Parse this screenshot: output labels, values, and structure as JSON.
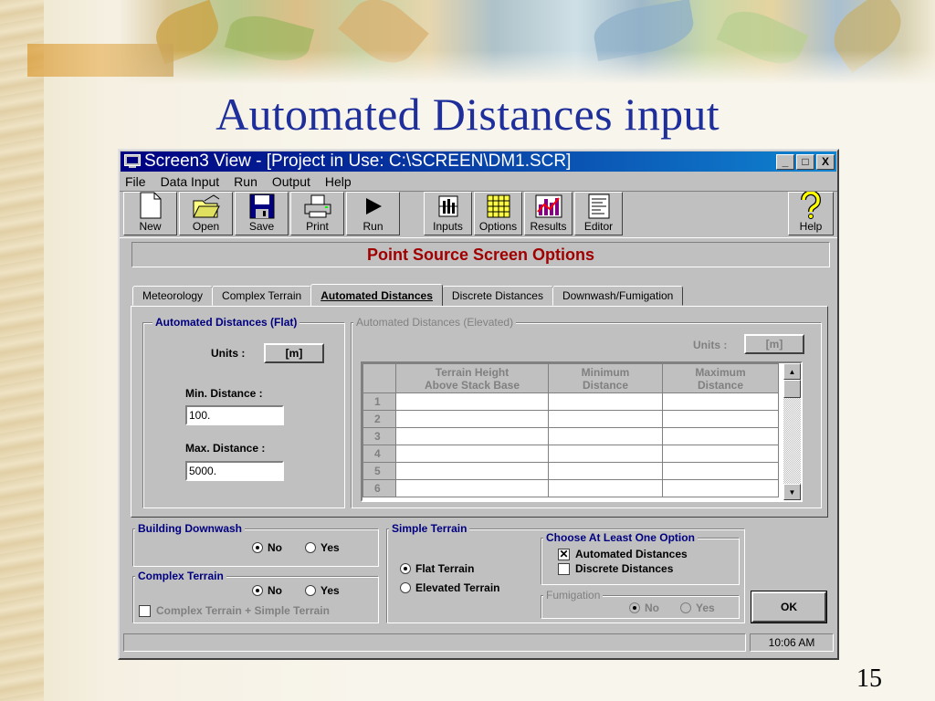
{
  "slide": {
    "title": "Automated Distances input",
    "page_number": "15"
  },
  "window": {
    "title": "Screen3 View - [Project in Use: C:\\SCREEN\\DM1.SCR]",
    "controls": [
      "_",
      "□",
      "X"
    ]
  },
  "menu": [
    "File",
    "Data Input",
    "Run",
    "Output",
    "Help"
  ],
  "toolbar": {
    "buttons": [
      {
        "label": "New",
        "icon": "new-document-icon"
      },
      {
        "label": "Open",
        "icon": "open-folder-icon"
      },
      {
        "label": "Save",
        "icon": "floppy-disk-icon"
      },
      {
        "label": "Print",
        "icon": "printer-icon"
      },
      {
        "label": "Run",
        "icon": "play-icon"
      },
      {
        "label": "Inputs",
        "icon": "inputs-icon"
      },
      {
        "label": "Options",
        "icon": "options-grid-icon"
      },
      {
        "label": "Results",
        "icon": "bar-chart-icon"
      },
      {
        "label": "Editor",
        "icon": "editor-document-icon"
      },
      {
        "label": "Help",
        "icon": "question-mark-icon"
      }
    ]
  },
  "screen_heading": "Point Source Screen Options",
  "tabs": [
    {
      "label": "Meteorology",
      "active": false
    },
    {
      "label": "Complex Terrain",
      "active": false
    },
    {
      "label": "Automated Distances",
      "active": true
    },
    {
      "label": "Discrete Distances",
      "active": false
    },
    {
      "label": "Downwash/Fumigation",
      "active": false
    }
  ],
  "flat": {
    "legend": "Automated Distances (Flat)",
    "units_label": "Units :",
    "units_value": "[m]",
    "min_label": "Min. Distance :",
    "min_value": "100.",
    "max_label": "Max. Distance :",
    "max_value": "5000."
  },
  "elevated": {
    "legend": "Automated Distances (Elevated)",
    "units_label": "Units :",
    "units_value": "[m]",
    "columns": [
      [
        "Terrain Height",
        "Above Stack Base"
      ],
      [
        "Minimum",
        "Distance"
      ],
      [
        "Maximum",
        "Distance"
      ]
    ],
    "rows": [
      "1",
      "2",
      "3",
      "4",
      "5",
      "6"
    ]
  },
  "building_downwash": {
    "legend": "Building Downwash",
    "options": [
      "No",
      "Yes"
    ],
    "selected": "No"
  },
  "complex_terrain": {
    "legend": "Complex Terrain",
    "options": [
      "No",
      "Yes"
    ],
    "selected": "No",
    "checkbox_label": "Complex Terrain + Simple Terrain",
    "checked": false
  },
  "simple_terrain": {
    "legend": "Simple Terrain",
    "options": [
      "Flat Terrain",
      "Elevated Terrain"
    ],
    "selected": "Flat Terrain"
  },
  "choose_option": {
    "legend": "Choose At Least One Option",
    "items": [
      {
        "label": "Automated Distances",
        "checked": true
      },
      {
        "label": "Discrete Distances",
        "checked": false
      }
    ]
  },
  "fumigation": {
    "legend": "Fumigation",
    "options": [
      "No",
      "Yes"
    ],
    "selected": "No"
  },
  "ok_label": "OK",
  "status": {
    "time": "10:06 AM"
  }
}
